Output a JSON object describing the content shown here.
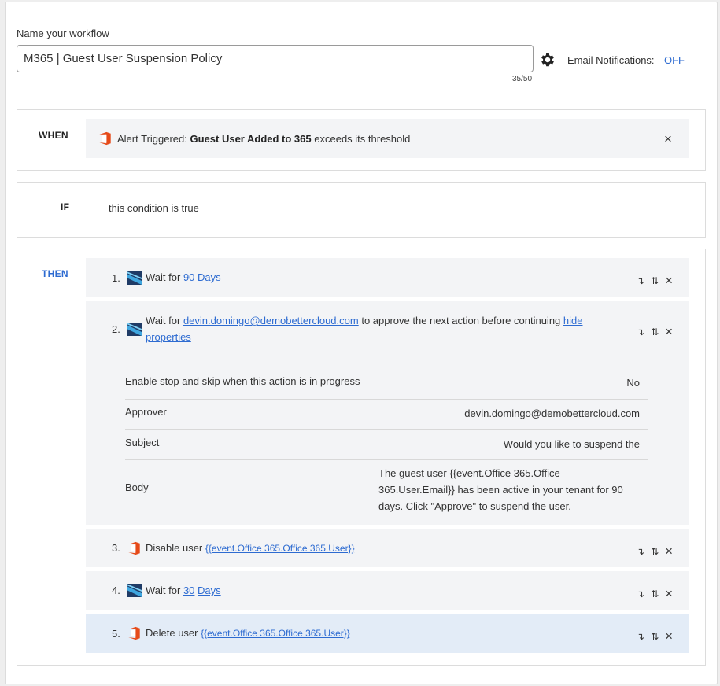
{
  "header": {
    "name_label": "Name your workflow",
    "workflow_name": "M365 | Guest User Suspension Policy",
    "char_count": "35/50",
    "email_label": "Email Notifications:",
    "email_value": "OFF"
  },
  "when": {
    "label": "WHEN",
    "prefix": "Alert Triggered:",
    "alert_name": "Guest User Added to 365",
    "suffix": "exceeds its threshold",
    "icon": "office365-icon",
    "close": "×"
  },
  "if": {
    "label": "IF",
    "text": "this condition is true"
  },
  "then": {
    "label": "THEN",
    "steps": [
      {
        "num": "1.",
        "icon": "bettercloud-icon",
        "prefix": "Wait for",
        "value": "90",
        "unit": "Days"
      },
      {
        "num": "2.",
        "icon": "bettercloud-icon",
        "prefix": "Wait for",
        "email": "devin.domingo@demobettercloud.com",
        "middle": "to approve the next action before continuing",
        "toggle_line1": "hide",
        "toggle_line2": "properties",
        "properties": [
          {
            "key": "Enable stop and skip when this action is in progress",
            "value": "No"
          },
          {
            "key": "Approver",
            "value": "devin.domingo@demobettercloud.com"
          },
          {
            "key": "Subject",
            "value": "Would you like to suspend the"
          },
          {
            "key": "Body",
            "value_line1": "The guest user {{event.Office 365.Office",
            "value_line2": "365.User.Email}} has been active in your tenant for 90",
            "value_line3": "days. Click \"Approve\" to suspend the user."
          }
        ]
      },
      {
        "num": "3.",
        "icon": "office365-icon",
        "prefix": "Disable user",
        "token": "{{event.Office 365.Office 365.User}}"
      },
      {
        "num": "4.",
        "icon": "bettercloud-icon",
        "prefix": "Wait for",
        "value": "30",
        "unit": "Days"
      },
      {
        "num": "5.",
        "icon": "office365-icon",
        "prefix": "Delete user",
        "token": "{{event.Office 365.Office 365.User}}"
      }
    ],
    "controls": {
      "move_down": "↴",
      "reorder": "⇅",
      "remove": "×"
    }
  },
  "colors": {
    "link": "#2d6bd1",
    "step_bg": "#f3f4f6",
    "active_step_bg": "#e3ecf7",
    "office_orange": "#e64a19"
  }
}
